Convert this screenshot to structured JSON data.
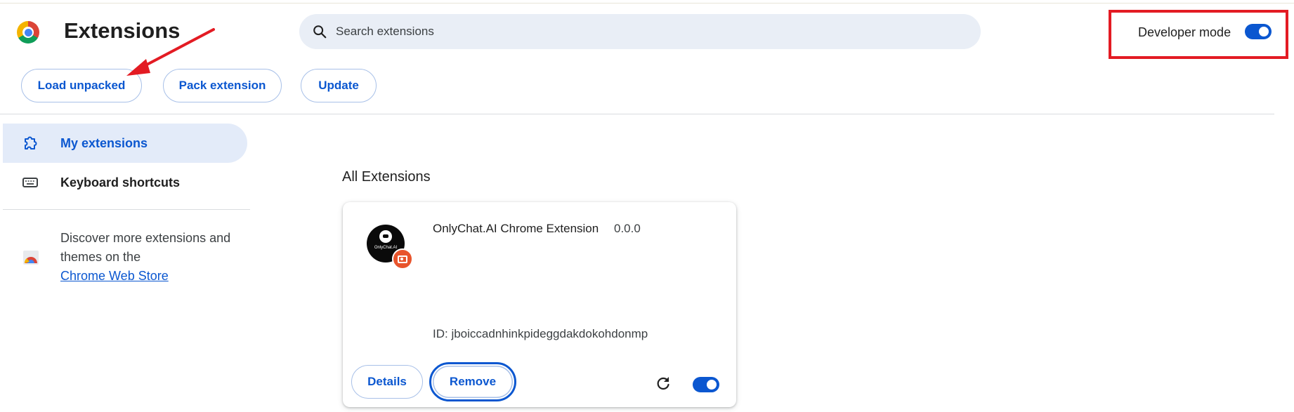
{
  "header": {
    "title": "Extensions",
    "search_placeholder": "Search extensions",
    "developer_mode_label": "Developer mode",
    "developer_mode_on": true
  },
  "actions": {
    "load_unpacked": "Load unpacked",
    "pack_extension": "Pack extension",
    "update": "Update"
  },
  "sidebar": {
    "items": [
      {
        "label": "My extensions",
        "icon": "puzzle-icon",
        "active": true
      },
      {
        "label": "Keyboard shortcuts",
        "icon": "keyboard-icon",
        "active": false
      }
    ],
    "discover_text": "Discover more extensions and themes on the",
    "store_link": "Chrome Web Store"
  },
  "main": {
    "section_title": "All Extensions",
    "extensions": [
      {
        "name": "OnlyChat.AI Chrome Extension",
        "version": "0.0.0",
        "id_text": "ID: jboiccadnhinkpideggdakdokohdonmp",
        "icon_text": "OnlyChat.AI",
        "details_label": "Details",
        "remove_label": "Remove",
        "enabled": true
      }
    ]
  },
  "colors": {
    "accent": "#0b57d0",
    "highlight_box": "#e31b23",
    "annotation_arrow": "#e31b23"
  }
}
